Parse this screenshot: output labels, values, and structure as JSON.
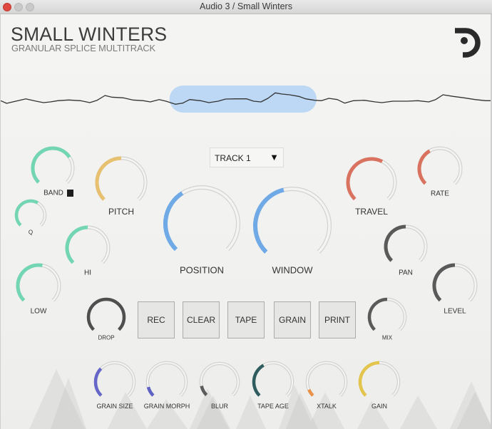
{
  "window": {
    "title": "Audio 3 / Small Winters",
    "traffic_lights": [
      "close",
      "minimize",
      "zoom"
    ]
  },
  "header": {
    "title": "SMALL WINTERS",
    "subtitle": "GRANULAR SPLICE MULTITRACK",
    "logo_icon": "brand-logo-icon"
  },
  "waveform": {
    "line_color": "#333333",
    "selection_color": "#bcd8f4",
    "selection": {
      "start": 0.343,
      "end": 0.642
    },
    "samples": [
      [
        0.0,
        -0.13
      ],
      [
        0.012,
        -0.5
      ],
      [
        0.051,
        0.13
      ],
      [
        0.072,
        -0.2
      ],
      [
        0.087,
        -0.4
      ],
      [
        0.101,
        -0.3
      ],
      [
        0.116,
        -0.13
      ],
      [
        0.138,
        -0.03
      ],
      [
        0.162,
        -0.13
      ],
      [
        0.181,
        -0.4
      ],
      [
        0.196,
        -0.07
      ],
      [
        0.212,
        0.6
      ],
      [
        0.225,
        0.37
      ],
      [
        0.249,
        0.27
      ],
      [
        0.268,
        -0.03
      ],
      [
        0.29,
        -0.13
      ],
      [
        0.304,
        -0.3
      ],
      [
        0.322,
        0.03
      ],
      [
        0.336,
        -0.2
      ],
      [
        0.355,
        -0.63
      ],
      [
        0.37,
        -0.47
      ],
      [
        0.384,
        0.03
      ],
      [
        0.406,
        -0.13
      ],
      [
        0.423,
        -0.4
      ],
      [
        0.442,
        -0.2
      ],
      [
        0.457,
        0.1
      ],
      [
        0.478,
        0.13
      ],
      [
        0.5,
        0.13
      ],
      [
        0.514,
        -0.2
      ],
      [
        0.529,
        -0.3
      ],
      [
        0.543,
        0.2
      ],
      [
        0.558,
        0.97
      ],
      [
        0.572,
        0.8
      ],
      [
        0.587,
        0.7
      ],
      [
        0.606,
        0.47
      ],
      [
        0.62,
        0.13
      ],
      [
        0.638,
        -0.07
      ],
      [
        0.652,
        -0.13
      ],
      [
        0.667,
        0.2
      ],
      [
        0.684,
        0.03
      ],
      [
        0.699,
        -0.47
      ],
      [
        0.717,
        -0.13
      ],
      [
        0.739,
        -0.07
      ],
      [
        0.761,
        -0.3
      ],
      [
        0.775,
        -0.4
      ],
      [
        0.797,
        -0.2
      ],
      [
        0.826,
        -0.2
      ],
      [
        0.848,
        -0.13
      ],
      [
        0.87,
        -0.3
      ],
      [
        0.884,
        0.03
      ],
      [
        0.899,
        0.7
      ],
      [
        0.92,
        0.47
      ],
      [
        0.942,
        0.27
      ],
      [
        0.964,
        0.03
      ],
      [
        0.986,
        -0.13
      ],
      [
        1.0,
        -0.13
      ]
    ]
  },
  "track_select": {
    "selected": "TRACK 1",
    "arrow_icon": "▼"
  },
  "band_toggle": {
    "checked": true
  },
  "knobs": [
    {
      "id": "band",
      "label": "BAND",
      "value": 0.71,
      "color": "#72d6b4"
    },
    {
      "id": "pitch",
      "label": "PITCH",
      "value": 0.5,
      "color": "#e7c16f"
    },
    {
      "id": "q",
      "label": "Q",
      "value": 0.61,
      "color": "#72d6b4"
    },
    {
      "id": "hi",
      "label": "HI",
      "value": 0.5,
      "color": "#72d6b4"
    },
    {
      "id": "low",
      "label": "LOW",
      "value": 0.54,
      "color": "#72d6b4"
    },
    {
      "id": "position",
      "label": "POSITION",
      "value": 0.38,
      "color": "#6fa9e6"
    },
    {
      "id": "window",
      "label": "WINDOW",
      "value": 0.45,
      "color": "#6fa9e6"
    },
    {
      "id": "travel",
      "label": "TRAVEL",
      "value": 0.6,
      "color": "#d9725e"
    },
    {
      "id": "rate",
      "label": "RATE",
      "value": 0.39,
      "color": "#d9725e"
    },
    {
      "id": "pan",
      "label": "PAN",
      "value": 0.5,
      "color": "#5a5a5a"
    },
    {
      "id": "level",
      "label": "LEVEL",
      "value": 0.5,
      "color": "#5a5a5a"
    },
    {
      "id": "drop",
      "label": "DROP",
      "value": 1.0,
      "color": "#4f4f4f"
    },
    {
      "id": "mix",
      "label": "MIX",
      "value": 0.5,
      "color": "#5a5a5a"
    },
    {
      "id": "grain-size",
      "label": "GRAIN SIZE",
      "value": 0.33,
      "color": "#6467c8"
    },
    {
      "id": "grain-morph",
      "label": "GRAIN MORPH",
      "value": 0.11,
      "color": "#5d62c4"
    },
    {
      "id": "blur",
      "label": "BLUR",
      "value": 0.12,
      "color": "#5c5c5c"
    },
    {
      "id": "tape-age",
      "label": "TAPE AGE",
      "value": 0.39,
      "color": "#2f5c5f"
    },
    {
      "id": "xtalk",
      "label": "XTALK",
      "value": 0.08,
      "color": "#e8924a"
    },
    {
      "id": "gain",
      "label": "GAIN",
      "value": 0.5,
      "color": "#e3c54e"
    }
  ],
  "buttons": [
    {
      "label": "REC"
    },
    {
      "label": "CLEAR"
    },
    {
      "label": "TAPE"
    },
    {
      "label": "GRAIN"
    },
    {
      "label": "PRINT"
    }
  ],
  "colors": {
    "knob_track": "#d2d2d2",
    "knob_track_inner": "#f4f4f2",
    "logo": "#2a2a2a"
  }
}
